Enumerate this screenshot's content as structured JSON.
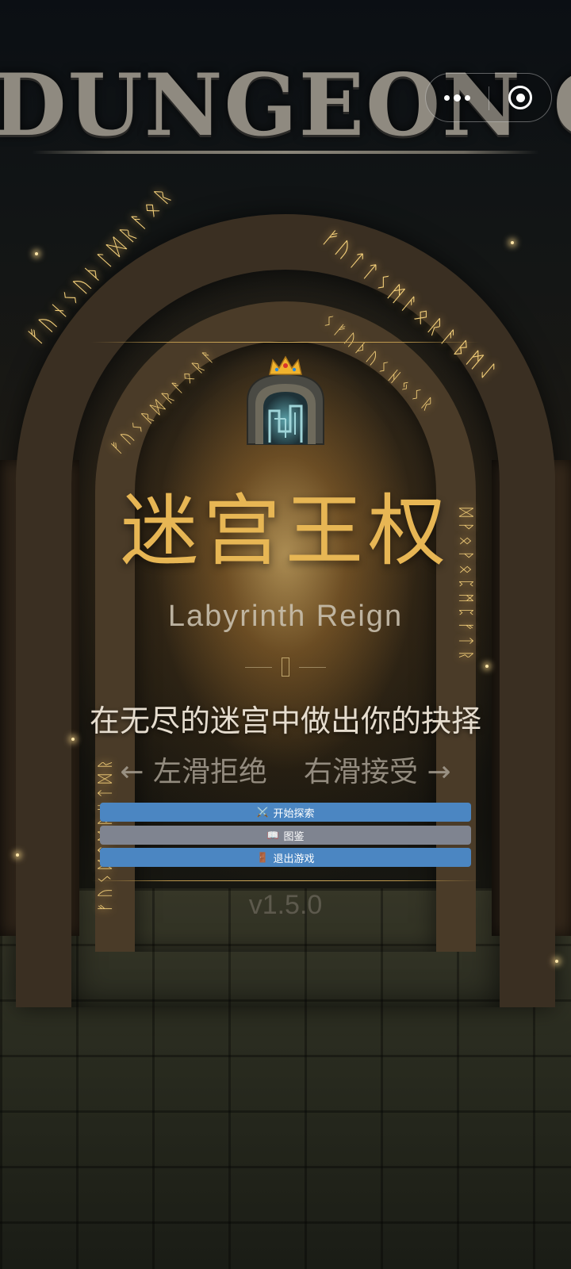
{
  "banner": {
    "title": "DUNGEON ODYSSEY"
  },
  "capsule": {
    "more_icon": "more-dots-icon",
    "close_icon": "target-close-icon"
  },
  "runes": {
    "outer_left": "ᚠᚢᚾᛊᚢᚦᛚᛞᚱᚨᛟᚱ",
    "outer_right": "ᚠᚢᛏᛏᛊᛗᚨᛟᚱᚨᛒᛗᛇ",
    "inner_left": "ᚠᚢᛊᚱᛞᚱᚨᛟᚱᚨ",
    "inner_right": "ᛊᚠᚢᚦᚢᛊᚺᛃᛊᚱ",
    "column_left": "ᚠᚢᛊᛞᛏᛞᚱᚺᛏᛞᚱ",
    "column_right": "ᛞᚹᛟᚹᛟᛈᛗᛈᚠᛏᚱ"
  },
  "game": {
    "title_cn": "迷宫王权",
    "title_en": "Labyrinth Reign",
    "tagline": "在无尽的迷宫中做出你的抉择",
    "hint_left": "← 左滑拒绝",
    "hint_right": "右滑接受 →",
    "version": "v1.5.0"
  },
  "menu": {
    "start": {
      "icon": "⚔️",
      "label": "开始探索"
    },
    "codex": {
      "icon": "📖",
      "label": "图鉴"
    },
    "exit": {
      "icon": "🚪",
      "label": "退出游戏"
    }
  },
  "colors": {
    "title_gold": "#e7b654",
    "button_blue": "#4b86c2",
    "button_gray": "#7f8490"
  }
}
